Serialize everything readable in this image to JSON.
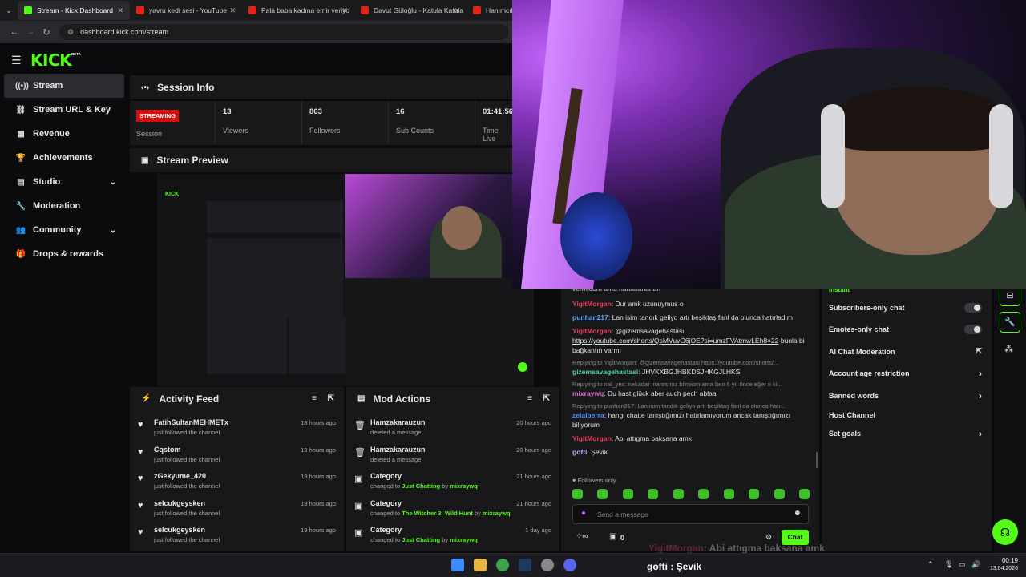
{
  "browser": {
    "tabs": [
      {
        "label": "Stream - Kick Dashboard",
        "color": "#53fc18",
        "active": true
      },
      {
        "label": "yavru kedi sesi - YouTube",
        "color": "#e62117"
      },
      {
        "label": "Pala baba kadına emir veriyo",
        "color": "#e62117"
      },
      {
        "label": "Davut Güloğlu - Katula Katula",
        "color": "#e62117"
      },
      {
        "label": "Hanımcılık",
        "color": "#e62117"
      }
    ],
    "url": "dashboard.kick.com/stream"
  },
  "header": {
    "logo": "KICK",
    "beta": "BETA"
  },
  "sidebar": {
    "items": [
      {
        "label": "Stream",
        "icon": "broadcast-icon",
        "glyph": "((•))"
      },
      {
        "label": "Stream URL & Key",
        "icon": "link-icon",
        "glyph": "⛓"
      },
      {
        "label": "Revenue",
        "icon": "chart-icon",
        "glyph": "▦"
      },
      {
        "label": "Achievements",
        "icon": "trophy-icon",
        "glyph": "🏆"
      },
      {
        "label": "Studio",
        "icon": "grid-icon",
        "glyph": "▤",
        "expand": true
      },
      {
        "label": "Moderation",
        "icon": "wrench-icon",
        "glyph": "🔧"
      },
      {
        "label": "Community",
        "icon": "users-icon",
        "glyph": "👥",
        "expand": true
      },
      {
        "label": "Drops & rewards",
        "icon": "gift-icon",
        "glyph": "🎁"
      }
    ]
  },
  "session": {
    "title": "Session Info",
    "badge": "STREAMING",
    "badge_label": "Session",
    "stats": [
      {
        "value": "13",
        "label": "Viewers"
      },
      {
        "value": "863",
        "label": "Followers"
      },
      {
        "value": "16",
        "label": "Sub Counts"
      },
      {
        "value": "01:41:56",
        "label": "Time Live"
      }
    ]
  },
  "preview": {
    "title": "Stream Preview"
  },
  "activity": {
    "title": "Activity Feed",
    "items": [
      {
        "name": "FatihSultanMEHMETx",
        "sub": "just followed the channel",
        "time": "18 hours ago"
      },
      {
        "name": "Cqstom",
        "sub": "just followed the channel",
        "time": "19 hours ago"
      },
      {
        "name": "zGekyume_420",
        "sub": "just followed the channel",
        "time": "19 hours ago"
      },
      {
        "name": "selcukgeysken",
        "sub": "just followed the channel",
        "time": "19 hours ago"
      },
      {
        "name": "selcukgeysken",
        "sub": "just followed the channel",
        "time": "19 hours ago"
      }
    ]
  },
  "mod": {
    "title": "Mod Actions",
    "items": [
      {
        "name": "Hamzakarauzun",
        "pre": "deleted a message",
        "hl": "",
        "mid": "",
        "by": "",
        "time": "20 hours ago",
        "icon": "trash-icon"
      },
      {
        "name": "Hamzakarauzun",
        "pre": "deleted a message",
        "hl": "",
        "mid": "",
        "by": "",
        "time": "20 hours ago",
        "icon": "trash-icon"
      },
      {
        "name": "Category",
        "pre": "changed to ",
        "hl": "Just Chatting",
        "mid": " by ",
        "by": "mixraywq",
        "time": "21 hours ago",
        "icon": "category-icon"
      },
      {
        "name": "Category",
        "pre": "changed to ",
        "hl": "The Witcher 3: Wild Hunt",
        "mid": " by ",
        "by": "mixraywq",
        "time": "21 hours ago",
        "icon": "category-icon"
      },
      {
        "name": "Category",
        "pre": "changed to ",
        "hl": "Just Chatting",
        "mid": " by ",
        "by": "mixraywq",
        "time": "1 day ago",
        "icon": "category-icon"
      }
    ]
  },
  "chat": {
    "top_partial": "vermicem ama hahahahahah",
    "messages": [
      {
        "reply": "",
        "user": "YigitMorgan",
        "color": "#e3405b",
        "text": "Dur amk uzunuymus o"
      },
      {
        "reply": "",
        "user": "punhan217",
        "color": "#5aa7ff",
        "text": "Lan isim tandık geliyo artı beşiktaş fanl da olunca hatırladım"
      },
      {
        "reply": "",
        "user": "YigitMorgan",
        "color": "#e3405b",
        "text": "@gizemsavagehastasi",
        "link": "https://youtube.com/shorts/QsMVuvO6jOE?si=umzFVAtmwLEh8×22",
        "after": "bunla bi bağkantın varmı"
      },
      {
        "reply": "Replying to YigitMorgan: @gizemsavagehastasi https://youtube.com/shorts/...",
        "user": "gizemsavagehastasi",
        "color": "#53d6a4",
        "text": "JHVKXBGJHBKDSJHKGJLHKS"
      },
      {
        "reply": "Replying to nal_yec: nekadar inanrsınız bilmiom ama ben 6 yıl önce eğer o ki...",
        "user": "mixraywq",
        "color": "#e36cd1",
        "text": "Du hast glück aber auch pech ablaa"
      },
      {
        "reply": "Replying to punhan217: Lan isim tandık geliyo artı beşiktaş fanl da olunca hatı...",
        "user": "zelalberra",
        "color": "#4f8dff",
        "text": "hangi chatte tanıştığımızı hatırlamıyorum ancak tanıştığımızı biliyorum"
      },
      {
        "reply": "",
        "user": "YigitMorgan",
        "color": "#e3405b",
        "text": "Abi attıgma baksana amk"
      },
      {
        "reply": "",
        "user": "gofti",
        "color": "#c9a9ff",
        "text": "Şevik"
      }
    ],
    "followers_only": "Followers only",
    "placeholder": "Send a message",
    "send_label": "Chat",
    "count": "0"
  },
  "settings": {
    "partial": "Instant",
    "rows": [
      {
        "label": "Subscribers-only chat",
        "type": "toggle"
      },
      {
        "label": "Emotes-only chat",
        "type": "toggle"
      },
      {
        "label": "AI Chat Moderation",
        "type": "external"
      },
      {
        "label": "Account age restriction",
        "type": "chevron"
      },
      {
        "label": "Banned words",
        "type": "chevron"
      },
      {
        "label": "Host Channel",
        "type": "none"
      },
      {
        "label": "Set goals",
        "type": "chevron"
      }
    ]
  },
  "overlay": {
    "line1_user": "YigitMorgan",
    "line1_text": ": Abi attıgma baksana amk",
    "line2": "gofti : Şevik"
  },
  "taskbar": {
    "time": "00:19",
    "date": "13.04.2026"
  }
}
